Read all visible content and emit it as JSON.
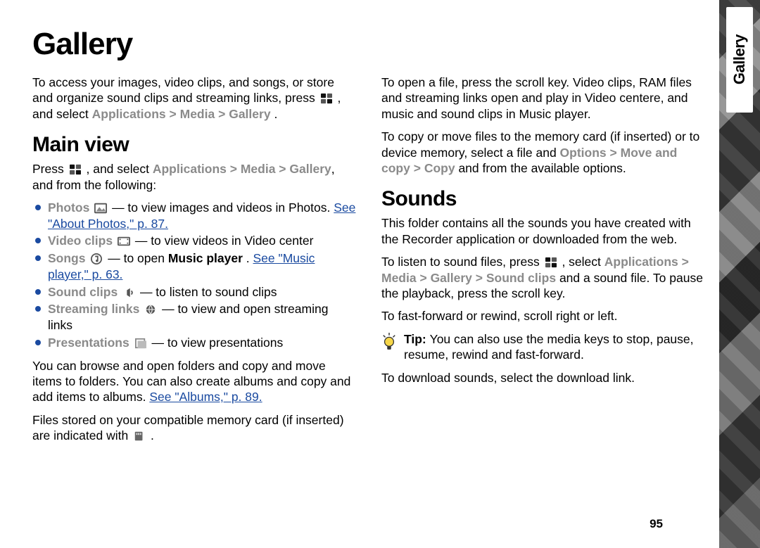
{
  "pagenum": "95",
  "side_tab": "Gallery",
  "title": "Gallery",
  "intro": {
    "pre": "To access your images, video clips, and songs, or store and organize sound clips and streaming links, press ",
    "post": " , and select ",
    "nav1": "Applications",
    "nav2": "Media",
    "nav3": "Gallery",
    "dot": "."
  },
  "mainview": {
    "heading": "Main view",
    "p1_pre": "Press ",
    "p1_mid": " , and select ",
    "p1_nav1": "Applications",
    "p1_nav2": "Media",
    "p1_nav3": "Gallery",
    "p1_tail": ", and from the following:",
    "items": [
      {
        "label": "Photos",
        "text": " — to view images and videos in Photos.",
        "link": "See \"About Photos,\" p. 87."
      },
      {
        "label": "Video clips",
        "text": " — to view videos in Video center"
      },
      {
        "label": "Songs",
        "text": " — to open ",
        "strong": "Music player",
        "dot": ". ",
        "link": "See \"Music player,\" p. 63."
      },
      {
        "label": "Sound clips",
        "text": " — to listen to sound clips"
      },
      {
        "label": "Streaming links",
        "text": " — to view and open streaming links"
      },
      {
        "label": "Presentations",
        "text": " — to view presentations"
      }
    ],
    "p2a": "You can browse and open folders and copy and move items to folders. You can also create albums and copy and add items to albums. ",
    "p2link": "See \"Albums,\" p. 89.",
    "p3a": "Files stored on your compatible memory card (if inserted) are indicated with ",
    "p3dot": "."
  },
  "col2": {
    "p1": "To open a file, press the scroll key. Video clips, RAM files and streaming links open and play in Video centere, and music and sound clips in Music player.",
    "p2a": "To copy or move files to the memory card (if inserted) or to device memory, select a file and ",
    "p2_opt": "Options",
    "p2_gt": " > ",
    "p2_move": "Move and copy",
    "p2_gt2": " > ",
    "p2_copy": "Copy",
    "p2_tail": " and from the available options."
  },
  "sounds": {
    "heading": "Sounds",
    "p1": "This folder contains all the sounds you have created with the Recorder application or downloaded from the web.",
    "p2_pre": "To listen to sound files, press ",
    "p2_mid": " , select ",
    "p2_nav1": "Applications",
    "p2_nav2": "Media",
    "p2_nav3": "Gallery",
    "p2_nav4": "Sound clips",
    "p2_tail": " and a sound file. To pause the playback, press the scroll key.",
    "p3": "To fast-forward or rewind, scroll right or left.",
    "tip_label": "Tip:  ",
    "tip_text": "You can also use the media keys to stop, pause, resume, rewind and fast-forward.",
    "p4": "To download sounds, select the download link."
  }
}
